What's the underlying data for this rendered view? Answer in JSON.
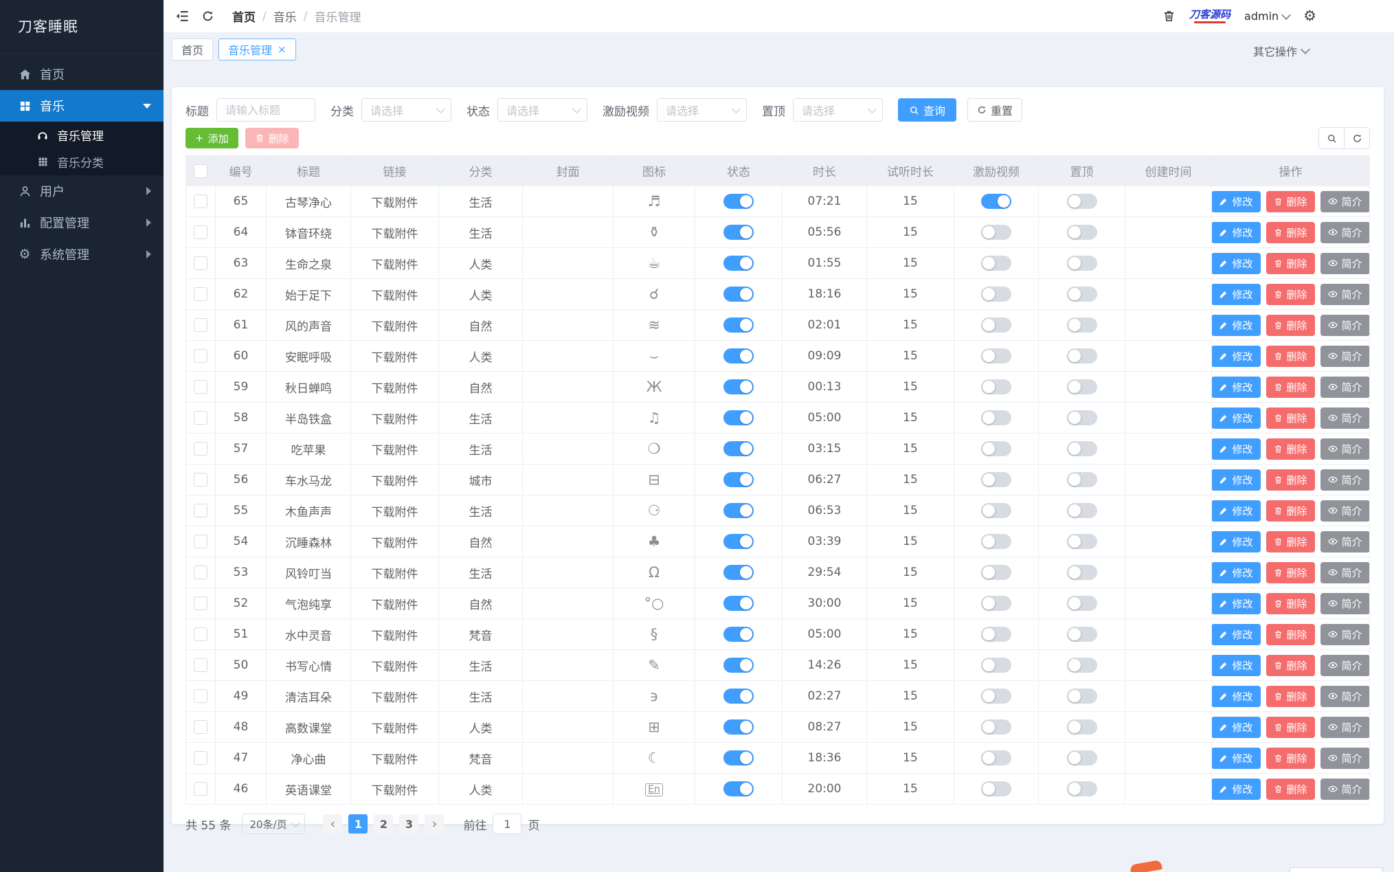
{
  "sidebar": {
    "logo": "刀客睡眠",
    "items": {
      "home": "首页",
      "music": "音乐",
      "music_manage": "音乐管理",
      "music_category": "音乐分类",
      "user": "用户",
      "config": "配置管理",
      "system": "系统管理"
    }
  },
  "topbar": {
    "breadcrumb": [
      "首页",
      "音乐",
      "音乐管理"
    ],
    "separator": "/",
    "brand": "刀客源码",
    "username": "admin"
  },
  "tabs": {
    "items": [
      {
        "label": "首页",
        "active": false
      },
      {
        "label": "音乐管理",
        "active": true,
        "close": "×"
      }
    ],
    "more": "其它操作"
  },
  "filters": {
    "title_label": "标题",
    "title_placeholder": "请输入标题",
    "category_label": "分类",
    "status_label": "状态",
    "incentive_label": "激励视频",
    "top_label": "置顶",
    "select_placeholder": "请选择",
    "search": "查询",
    "reset": "重置"
  },
  "toolbar": {
    "plus": "+",
    "add": "添加",
    "delete": "删除"
  },
  "table": {
    "headers": [
      "编号",
      "标题",
      "链接",
      "分类",
      "封面",
      "图标",
      "状态",
      "时长",
      "试听时长",
      "激励视频",
      "置顶",
      "创建时间",
      "操作"
    ],
    "link_text": "下载附件",
    "action_labels": {
      "edit": "修改",
      "delete": "删除",
      "info": "简介"
    },
    "rows": [
      {
        "id": 65,
        "title": "古琴净心",
        "category": "生活",
        "icon": "lyre",
        "duration": "07:21",
        "trial": 15,
        "status": true,
        "incentive": true,
        "top": false
      },
      {
        "id": 64,
        "title": "钵音环绕",
        "category": "生活",
        "icon": "singing-bowl",
        "duration": "05:56",
        "trial": 15,
        "status": true,
        "incentive": false,
        "top": false
      },
      {
        "id": 63,
        "title": "生命之泉",
        "category": "人类",
        "icon": "steaming-cup",
        "duration": "01:55",
        "trial": 15,
        "status": true,
        "incentive": false,
        "top": false
      },
      {
        "id": 62,
        "title": "始于足下",
        "category": "人类",
        "icon": "footprints",
        "duration": "18:16",
        "trial": 15,
        "status": true,
        "incentive": false,
        "top": false
      },
      {
        "id": 61,
        "title": "风的声音",
        "category": "自然",
        "icon": "wind",
        "duration": "02:01",
        "trial": 15,
        "status": true,
        "incentive": false,
        "top": false
      },
      {
        "id": 60,
        "title": "安眠呼吸",
        "category": "人类",
        "icon": "lips",
        "duration": "09:09",
        "trial": 15,
        "status": true,
        "incentive": false,
        "top": false
      },
      {
        "id": 59,
        "title": "秋日蝉鸣",
        "category": "自然",
        "icon": "cicada",
        "duration": "00:13",
        "trial": 15,
        "status": true,
        "incentive": false,
        "top": false
      },
      {
        "id": 58,
        "title": "半岛铁盒",
        "category": "生活",
        "icon": "music-box",
        "duration": "05:00",
        "trial": 15,
        "status": true,
        "incentive": false,
        "top": false
      },
      {
        "id": 57,
        "title": "吃苹果",
        "category": "生活",
        "icon": "apple",
        "duration": "03:15",
        "trial": 15,
        "status": true,
        "incentive": false,
        "top": false
      },
      {
        "id": 56,
        "title": "车水马龙",
        "category": "城市",
        "icon": "car",
        "duration": "06:27",
        "trial": 15,
        "status": true,
        "incentive": false,
        "top": false
      },
      {
        "id": 55,
        "title": "木鱼声声",
        "category": "生活",
        "icon": "wooden-fish",
        "duration": "06:53",
        "trial": 15,
        "status": true,
        "incentive": false,
        "top": false
      },
      {
        "id": 54,
        "title": "沉睡森林",
        "category": "自然",
        "icon": "forest",
        "duration": "03:39",
        "trial": 15,
        "status": true,
        "incentive": false,
        "top": false
      },
      {
        "id": 53,
        "title": "风铃叮当",
        "category": "生活",
        "icon": "wind-chime",
        "duration": "29:54",
        "trial": 15,
        "status": true,
        "incentive": false,
        "top": false
      },
      {
        "id": 52,
        "title": "气泡纯享",
        "category": "自然",
        "icon": "bubbles",
        "duration": "30:00",
        "trial": 15,
        "status": true,
        "incentive": false,
        "top": false
      },
      {
        "id": 51,
        "title": "水中灵音",
        "category": "梵音",
        "icon": "treble-clef",
        "duration": "05:00",
        "trial": 15,
        "status": true,
        "incentive": false,
        "top": false
      },
      {
        "id": 50,
        "title": "书写心情",
        "category": "生活",
        "icon": "pencil",
        "duration": "14:26",
        "trial": 15,
        "status": true,
        "incentive": false,
        "top": false
      },
      {
        "id": 49,
        "title": "清洁耳朵",
        "category": "生活",
        "icon": "ear",
        "duration": "02:27",
        "trial": 15,
        "status": true,
        "incentive": false,
        "top": false
      },
      {
        "id": 48,
        "title": "高数课堂",
        "category": "人类",
        "icon": "math",
        "duration": "08:27",
        "trial": 15,
        "status": true,
        "incentive": false,
        "top": false
      },
      {
        "id": 47,
        "title": "净心曲",
        "category": "梵音",
        "icon": "moon-sleep",
        "duration": "18:36",
        "trial": 15,
        "status": true,
        "incentive": false,
        "top": false
      },
      {
        "id": 46,
        "title": "英语课堂",
        "category": "人类",
        "icon": "english",
        "duration": "20:00",
        "trial": 15,
        "status": true,
        "incentive": false,
        "top": false
      }
    ]
  },
  "icon_glyphs": {
    "lyre": "♬",
    "singing-bowl": "⚱",
    "steaming-cup": "☕",
    "footprints": "☌",
    "wind": "≋",
    "lips": "⌣",
    "cicada": "Ж",
    "music-box": "♫",
    "apple": "❍",
    "car": "⊟",
    "wooden-fish": "⚆",
    "forest": "♣",
    "wind-chime": "Ω",
    "bubbles": "°○",
    "treble-clef": "§",
    "pencil": "✎",
    "ear": "϶",
    "math": "⊞",
    "moon-sleep": "☾",
    "english": "En"
  },
  "pagination": {
    "total": "共 55 条",
    "page_size": "20条/页",
    "pages": [
      "1",
      "2",
      "3"
    ],
    "current": "1",
    "prev": "‹",
    "next": "›",
    "goto_label": "前往",
    "goto_value": "1",
    "goto_suffix": "页"
  },
  "colors": {
    "primary": "#409eff",
    "success": "#64bd35",
    "danger": "#f56c6c",
    "info": "#909399",
    "sidebar_active": "#1379cd"
  }
}
